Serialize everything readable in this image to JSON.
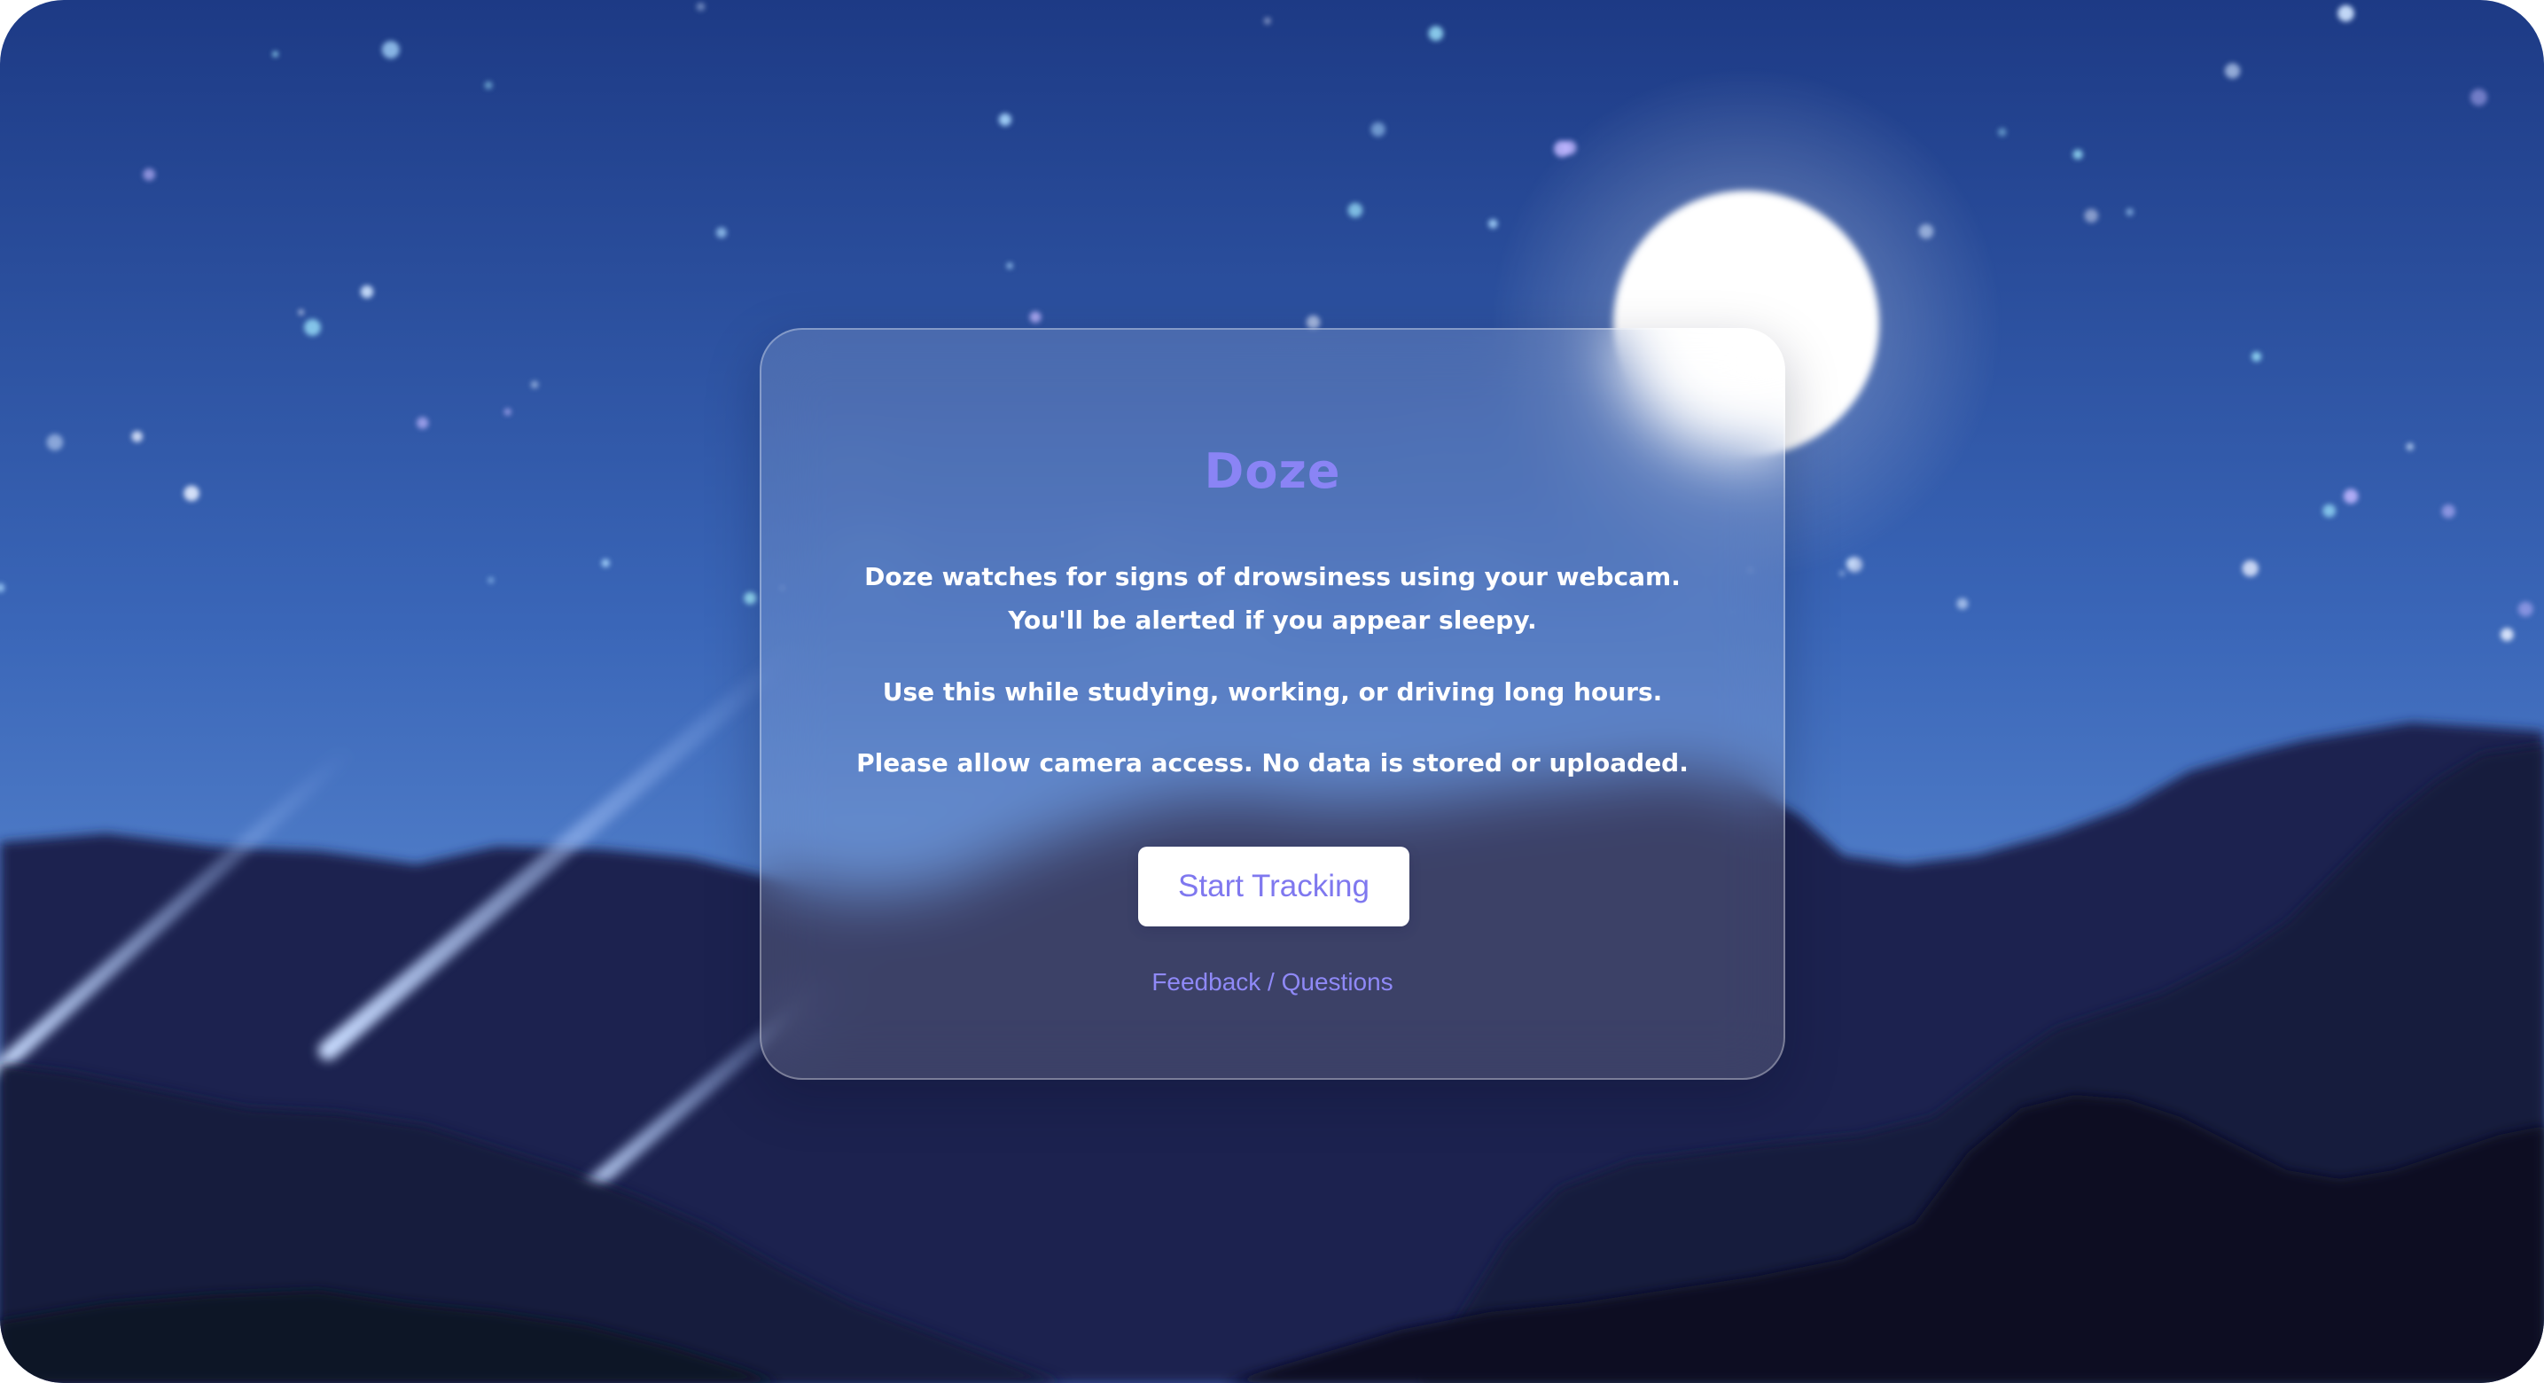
{
  "app": {
    "title": "Doze"
  },
  "intro": {
    "paragraph_1": "Doze watches for signs of drowsiness using your webcam. You'll be alerted if you appear sleepy.",
    "paragraph_2": "Use this while studying, working, or driving long hours.",
    "paragraph_3": "Please allow camera access. No data is stored or uploaded."
  },
  "actions": {
    "start_label": "Start Tracking",
    "feedback_label": "Feedback / Questions"
  },
  "theme": {
    "accent": "#8a84f5",
    "sky_top": "#1d3a85",
    "sky_bottom": "#5a88d0",
    "mountains": "#1a1d44",
    "button_bg": "#ffffff"
  }
}
